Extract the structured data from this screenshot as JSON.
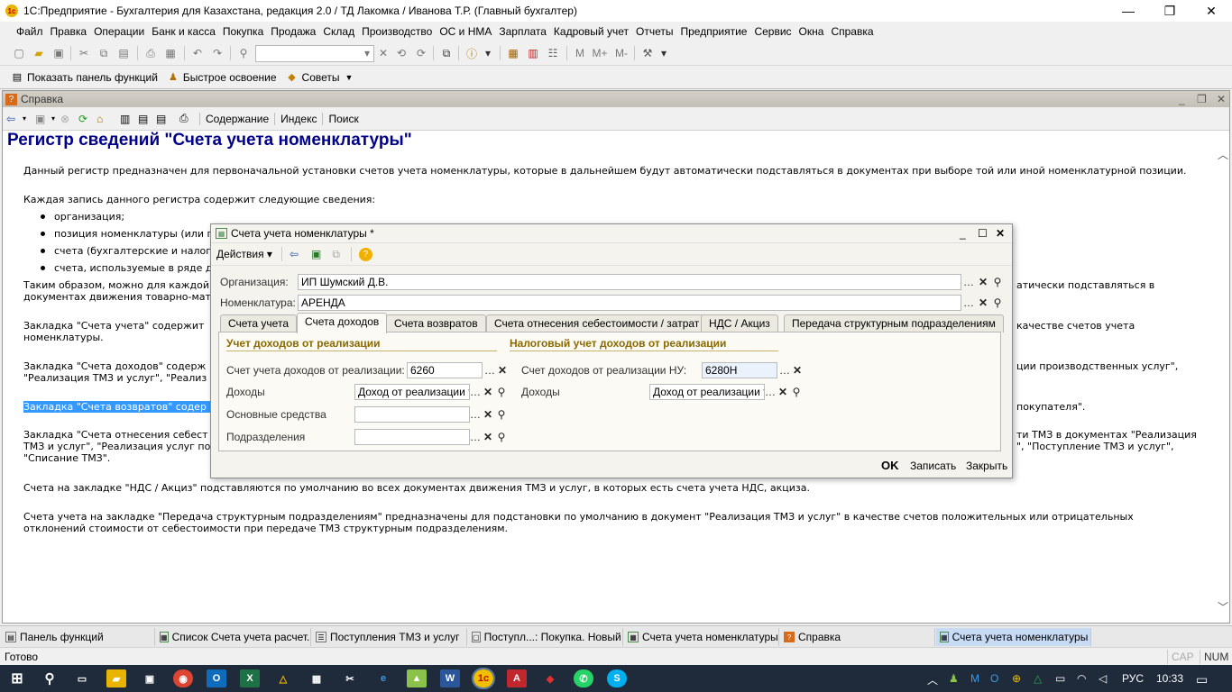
{
  "window": {
    "title": "1С:Предприятие - Бухгалтерия для Казахстана, редакция 2.0 / ТД Лакомка / Иванова Т.Р. (Главный бухгалтер)"
  },
  "menu": [
    "Файл",
    "Правка",
    "Операции",
    "Банк и касса",
    "Покупка",
    "Продажа",
    "Склад",
    "Производство",
    "ОС и НМА",
    "Зарплата",
    "Кадровый учет",
    "Отчеты",
    "Предприятие",
    "Сервис",
    "Окна",
    "Справка"
  ],
  "toolbar2": {
    "panel": "Показать панель функций",
    "quick": "Быстрое освоение",
    "tips": "Советы"
  },
  "help": {
    "window_title": "Справка",
    "links": {
      "contents": "Содержание",
      "index": "Индекс",
      "search": "Поиск"
    },
    "heading": "Регистр сведений \"Счета учета номенклатуры\"",
    "p1": "Данный регистр предназначен для первоначальной установки счетов учета номенклатуры, которые в дальнейшем будут автоматически подставляться в документах при выборе той или иной номенклатурной позиции.",
    "p2": "Каждая запись данного регистра содержит следующие сведения:",
    "bullets": [
      "организация;",
      "позиция номенклатуры (или г",
      "счета (бухгалтерские и налог",
      "счета, используемые в ряде д"
    ],
    "p3a": "Таким образом, можно для каждой",
    "p3a_end": "атически подставляться в",
    "p3b": "документах движения товарно-мат",
    "p4a": "Закладка \"Счета учета\" содержит",
    "p4a_end": "качестве счетов учета",
    "p4b": "номенклатуры.",
    "p5a": "Закладка \"Счета доходов\" содерж",
    "p5a_end": "ции производственных услуг\",",
    "p5b": "\"Реализация ТМЗ и услуг\", \"Реализ",
    "p6_sel": "Закладка \"Счета возвратов\" содер",
    "p6_end": "покупателя\".",
    "p7a": "Закладка \"Счета отнесения себест",
    "p7a_end": "ти ТМЗ в документах \"Реализация",
    "p7b": "ТМЗ и услуг\", \"Реализация услуг по",
    "p7b_end": "\", \"Поступление ТМЗ и услуг\",",
    "p7c": "\"Списание ТМЗ\".",
    "p8": "Счета на закладке \"НДС / Акциз\" подставляются по умолчанию во всех документах движения ТМЗ и услуг, в которых есть счета учета НДС, акциза.",
    "p9a": "Счета учета на закладке \"Передача структурным подразделениям\" предназначены для подстановки по умолчанию в документ \"Реализация ТМЗ и услуг\" в качестве счетов положительных или отрицательных",
    "p9b": "отклонений стоимости от себестоимости при передаче ТМЗ структурным подразделениям."
  },
  "dialog": {
    "title": "Счета учета номенклатуры *",
    "actions": "Действия",
    "org_label": "Организация:",
    "org_value": "ИП Шумский Д.В.",
    "nom_label": "Номенклатура:",
    "nom_value": "АРЕНДА",
    "tabs": [
      "Счета учета",
      "Счета доходов",
      "Счета возвратов",
      "Счета отнесения себестоимости / затрат",
      "НДС / Акциз",
      "Передача структурным подразделениям"
    ],
    "grp1": "Учет доходов от реализации",
    "grp2": "Налоговый учет доходов от реализации",
    "acc_label": "Счет учета доходов от реализации:",
    "acc_value": "6260",
    "inc_label": "Доходы",
    "inc_value": "Доход от реализации то",
    "os_label": "Основные средства",
    "dep_label": "Подразделения",
    "nu_label": "Счет доходов от реализации НУ:",
    "nu_value": "6280Н",
    "nu_inc_label": "Доходы",
    "nu_inc_value": "Доход от реализации то",
    "ok": "OK",
    "save": "Записать",
    "close": "Закрыть"
  },
  "windows_bar": [
    "Панель функций",
    "Список Счета учета расчет...",
    "Поступления ТМЗ и услуг",
    "Поступл...: Покупка. Новый *",
    "Счета учета номенклатуры",
    "Справка",
    "Счета учета номенклатуры *"
  ],
  "status": {
    "text": "Готово",
    "cap": "CAP",
    "num": "NUM"
  },
  "taskbar": {
    "lang": "РУС",
    "time": "10:33"
  }
}
